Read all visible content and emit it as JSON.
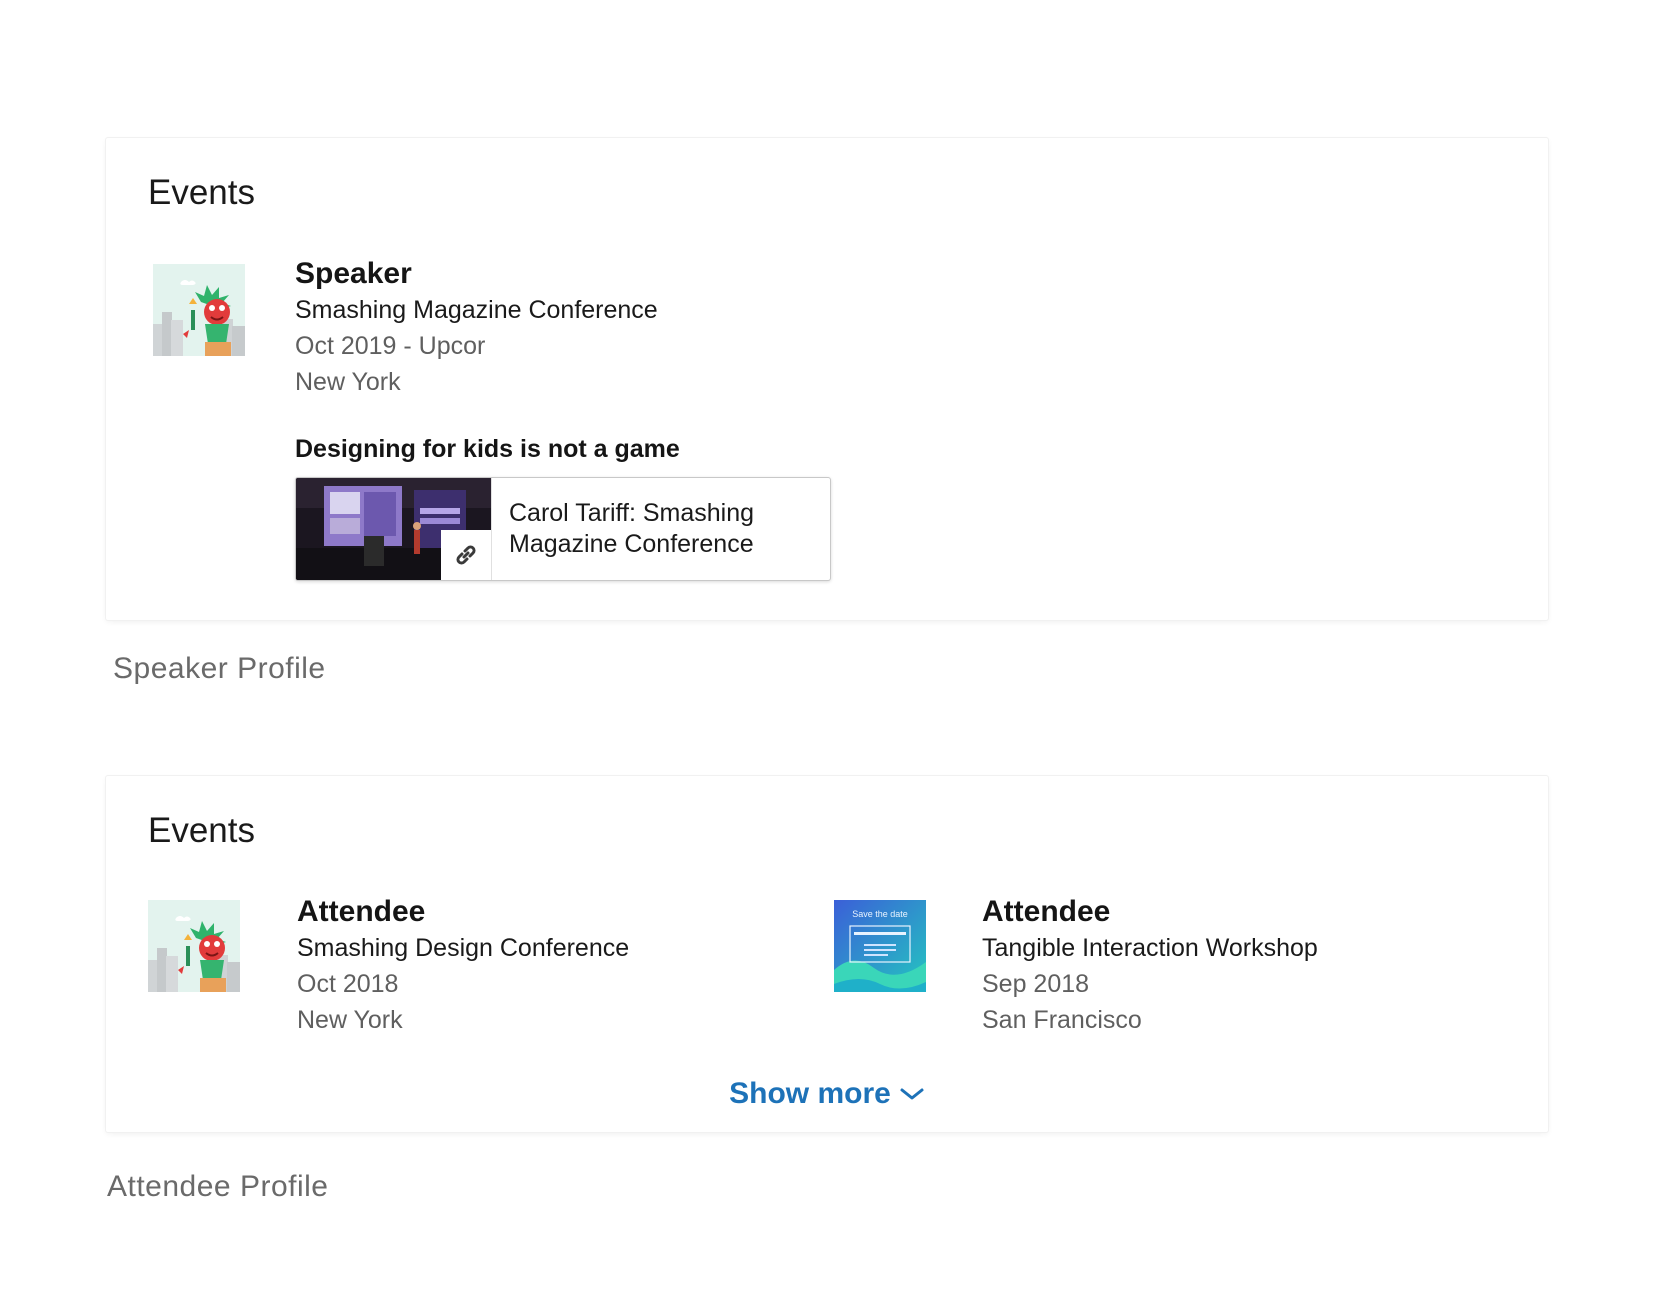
{
  "speaker_profile": {
    "card_title": "Events",
    "event": {
      "role": "Speaker",
      "name": "Smashing Magazine Conference",
      "dates": "Oct 2019 - Upcor",
      "location": "New York",
      "thumb_icon": "statue-of-liberty-illustration"
    },
    "talk": {
      "title": "Designing for kids is not a game",
      "media_title": "Carol Tariff: Smashing Magazine Conference",
      "media_icon": "link-icon"
    },
    "caption": "Speaker Profile"
  },
  "attendee_profile": {
    "card_title": "Events",
    "events": [
      {
        "role": "Attendee",
        "name": "Smashing Design Conference",
        "dates": "Oct 2018",
        "location": "New York",
        "thumb_icon": "statue-of-liberty-illustration"
      },
      {
        "role": "Attendee",
        "name": "Tangible Interaction Workshop",
        "dates": "Sep 2018",
        "location": "San Francisco",
        "thumb_icon": "save-the-date-poster",
        "thumb_text": "Save the date"
      }
    ],
    "show_more_label": "Show more",
    "caption": "Attendee Profile"
  },
  "colors": {
    "link_blue": "#1d72b8",
    "muted_text": "#5f5f5f",
    "caption_gray": "#6a6a6a"
  }
}
